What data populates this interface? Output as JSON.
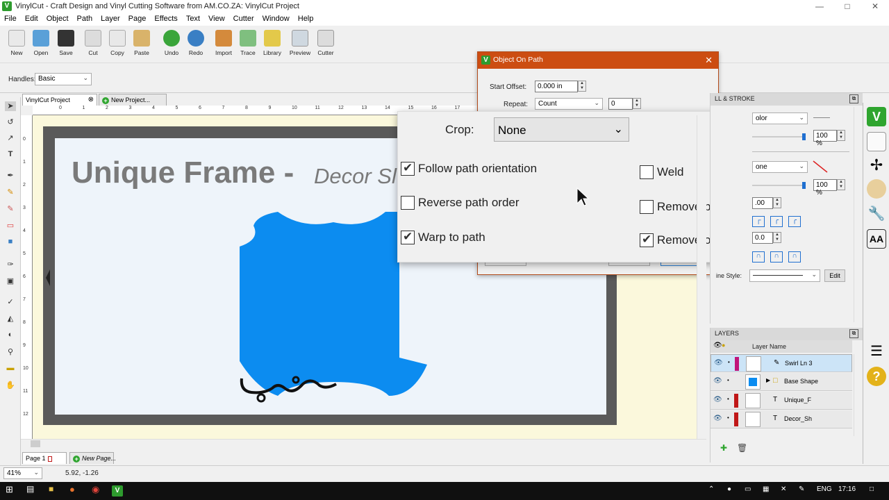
{
  "window": {
    "title": "VinylCut - Craft Design and Vinyl Cutting Software from AM.CO.ZA: VinylCut Project"
  },
  "menu": [
    "File",
    "Edit",
    "Object",
    "Path",
    "Layer",
    "Page",
    "Effects",
    "Text",
    "View",
    "Cutter",
    "Window",
    "Help"
  ],
  "toolbar": [
    {
      "label": "New",
      "icon": "new-icon",
      "color": "#e9e9e9"
    },
    {
      "label": "Open",
      "icon": "open-icon",
      "color": "#5aa0d8"
    },
    {
      "label": "Save",
      "icon": "save-icon",
      "color": "#333333"
    },
    {
      "label": "Cut",
      "icon": "cut-icon",
      "color": "#dcdcdc"
    },
    {
      "label": "Copy",
      "icon": "copy-icon",
      "color": "#e8e8e8"
    },
    {
      "label": "Paste",
      "icon": "paste-icon",
      "color": "#d9b36a"
    },
    {
      "label": "Undo",
      "icon": "undo-icon",
      "color": "#3aa53a"
    },
    {
      "label": "Redo",
      "icon": "redo-icon",
      "color": "#3a7fc4"
    },
    {
      "label": "Import",
      "icon": "import-icon",
      "color": "#d48a3c"
    },
    {
      "label": "Trace",
      "icon": "trace-icon",
      "color": "#7fbf7f"
    },
    {
      "label": "Library",
      "icon": "library-icon",
      "color": "#e3c94a"
    },
    {
      "label": "Preview",
      "icon": "preview-icon",
      "color": "#cfd8e0"
    },
    {
      "label": "Cutter",
      "icon": "cutter-icon",
      "color": "#dcdcdc"
    }
  ],
  "options": {
    "handles_label": "Handles:",
    "handles_value": "Basic"
  },
  "doc_tabs": {
    "active": "VinylCut Project",
    "new": "New Project..."
  },
  "ruler_numbers": [
    "0",
    "1",
    "2",
    "3",
    "4",
    "5",
    "6",
    "7",
    "8",
    "9",
    "10",
    "11",
    "12",
    "13",
    "14",
    "15",
    "16",
    "17"
  ],
  "ruler_v_numbers": [
    "0",
    "1",
    "2",
    "3",
    "4",
    "5",
    "6",
    "7",
    "8",
    "9",
    "10",
    "11",
    "12"
  ],
  "canvas": {
    "title_text": "Unique Frame -",
    "subtitle_text": "Decor Sl",
    "shape_color": "#0c8cf0"
  },
  "dialog": {
    "title": "Object On Path",
    "start_offset_label": "Start Offset:",
    "start_offset_value": "0.000 in",
    "repeat_label": "Repeat:",
    "repeat_value": "Count",
    "repeat_count": "0"
  },
  "zoom": {
    "crop_label": "Crop:",
    "crop_value": "None",
    "options": [
      {
        "label": "Follow path orientation",
        "checked": true
      },
      {
        "label": "Reverse path order",
        "checked": false
      },
      {
        "label": "Warp to path",
        "checked": true
      },
      {
        "label": "Weld",
        "checked": false
      },
      {
        "label": "Remove path",
        "checked": false
      },
      {
        "label": "Remove original c",
        "checked": true
      }
    ]
  },
  "fill_stroke": {
    "title": "LL & STROKE",
    "fill_type": "olor",
    "opacity1": "100 %",
    "stroke_type": "one",
    "opacity2": "100 %",
    "val1": ".00",
    "val2": "0.0",
    "line_style_label": "ine Style:",
    "edit_label": "Edit"
  },
  "layers": {
    "title": "LAYERS",
    "column": "Layer Name",
    "rows": [
      {
        "name": "Swirl Ln 3",
        "color": "#c0157a"
      },
      {
        "name": "Base Shape",
        "color": "#0c8cf0"
      },
      {
        "name": "Unique_F",
        "color": "#c01717"
      },
      {
        "name": "Decor_Sh",
        "color": "#c01717"
      }
    ]
  },
  "page_tabs": {
    "active": "Page 1",
    "new": "New Page..."
  },
  "status": {
    "zoom": "41%",
    "coords": "5.92, -1.26"
  },
  "taskbar": {
    "lang": "ENG",
    "time": "17:16"
  }
}
